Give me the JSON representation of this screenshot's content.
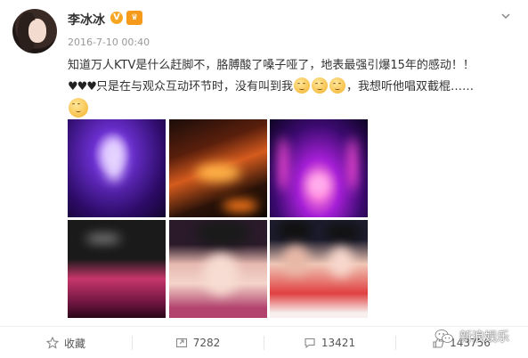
{
  "post": {
    "username": "李冰冰",
    "verified_badge": "V",
    "vip_badge": "VIP",
    "timestamp": "2016-7-10 00:40",
    "text_line1": "知道万人KTV是什么赶脚不，胳膊酸了嗓子哑了，地表最强引爆15年的感动！！",
    "text_line2_hearts": "♥♥♥",
    "text_line2_a": "只是在与观众互动环节时，没有叫到我",
    "text_line2_b": "，我想听他唱双截棍……",
    "emoji_name": "sad-face-emoji"
  },
  "gallery": {
    "photos": [
      "photo-1",
      "photo-2",
      "photo-3",
      "photo-4",
      "photo-5",
      "photo-6"
    ]
  },
  "actions": {
    "favorite_label": "收藏",
    "repost_count": "7282",
    "comment_count": "13421",
    "like_count": "143756"
  },
  "watermark": {
    "label": "新浪娱乐"
  },
  "colors": {
    "accent": "#f6a623",
    "text": "#333333",
    "muted": "#999999"
  }
}
